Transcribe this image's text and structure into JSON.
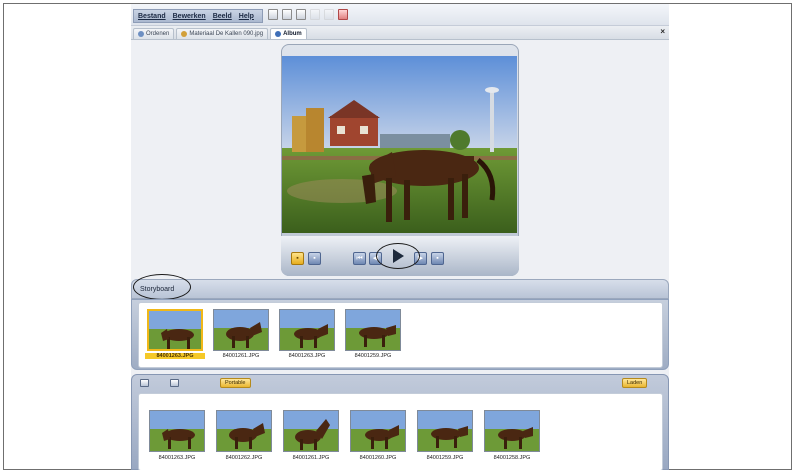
{
  "menu": {
    "items": [
      "Bestand",
      "Bewerken",
      "Beeld",
      "Help"
    ]
  },
  "toolbar": {
    "icons": [
      "new-icon",
      "copy-icon",
      "paste-icon",
      "undo-icon",
      "redo-icon",
      "delete-icon"
    ]
  },
  "tabs": [
    {
      "label": "Ordenen",
      "active": false
    },
    {
      "label": "Materiaal De Kallen 090.jpg",
      "active": false
    },
    {
      "label": "Album",
      "active": true
    }
  ],
  "tab_close": "×",
  "preview": {
    "image_subject": "horse-photo",
    "controls": [
      "photo-mode",
      "video-mode",
      "first-frame",
      "previous-frame",
      "play",
      "next-frame",
      "export"
    ]
  },
  "storyboard": {
    "title": "Storyboard",
    "items": [
      {
        "caption": "84001263.JPG",
        "selected": true
      },
      {
        "caption": "84001261.JPG",
        "selected": false
      },
      {
        "caption": "84001263.JPG",
        "selected": false
      },
      {
        "caption": "84001259.JPG",
        "selected": false
      }
    ]
  },
  "browser": {
    "pill_left": "Portable",
    "pill_right": "Laden",
    "items": [
      {
        "caption": "84001263.JPG"
      },
      {
        "caption": "84001262.JPG"
      },
      {
        "caption": "84001261.JPG"
      },
      {
        "caption": "84001260.JPG"
      },
      {
        "caption": "84001259.JPG"
      },
      {
        "caption": "84001258.JPG"
      }
    ]
  },
  "colors": {
    "accent_yellow": "#f5c928",
    "panel_blue": "#a9b7cd",
    "background": "#eef0f4"
  }
}
